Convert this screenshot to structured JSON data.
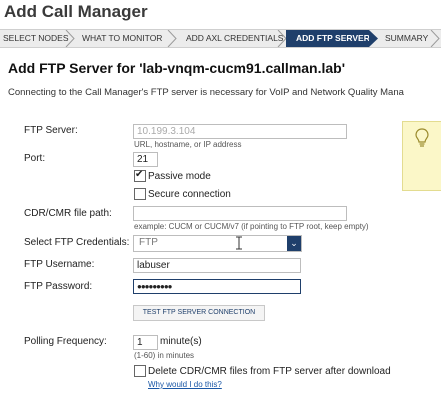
{
  "page": {
    "title": "Add Call Manager"
  },
  "wizard": {
    "steps": [
      {
        "label": "SELECT NODES"
      },
      {
        "label": "WHAT TO MONITOR"
      },
      {
        "label": "ADD AXL CREDENTIALS"
      },
      {
        "label": "ADD FTP SERVER",
        "active": true
      },
      {
        "label": "SUMMARY"
      }
    ]
  },
  "section": {
    "title": "Add FTP Server for 'lab-vnqm-cucm91.callman.lab'",
    "description": "Connecting to the Call Manager's FTP server is necessary for VoIP and Network Quality Mana"
  },
  "form": {
    "ftp_server": {
      "label": "FTP Server:",
      "value": "10.199.3.104",
      "hint": "URL, hostname, or IP address"
    },
    "port": {
      "label": "Port:",
      "value": "21"
    },
    "passive_mode": {
      "label": "Passive mode",
      "checked": true
    },
    "secure_connection": {
      "label": "Secure connection",
      "checked": false
    },
    "cdr_path": {
      "label": "CDR/CMR file path:",
      "value": "",
      "hint": "example: CUCM or CUCM/v7 (if pointing to FTP root, keep empty)"
    },
    "credentials": {
      "label": "Select FTP Credentials:",
      "value": "FTP"
    },
    "username": {
      "label": "FTP Username:",
      "value": "labuser"
    },
    "password": {
      "label": "FTP Password:",
      "value": "●●●●●●●●●"
    },
    "test_button": {
      "label": "TEST FTP SERVER CONNECTION"
    },
    "polling": {
      "label": "Polling Frequency:",
      "value": "1",
      "unit": "minute(s)",
      "hint": "(1-60) in minutes"
    },
    "delete_files": {
      "label": "Delete CDR/CMR files from FTP server after download",
      "checked": false
    },
    "why_link": "Why would I do this?"
  },
  "icons": {
    "tip": "lightbulb-icon",
    "dropdown": "chevron-down-icon",
    "cursor": "text-cursor-icon"
  },
  "colors": {
    "accent": "#1f3f6b",
    "link": "#1a57a6",
    "tip_bg": "#fbf7c8"
  }
}
